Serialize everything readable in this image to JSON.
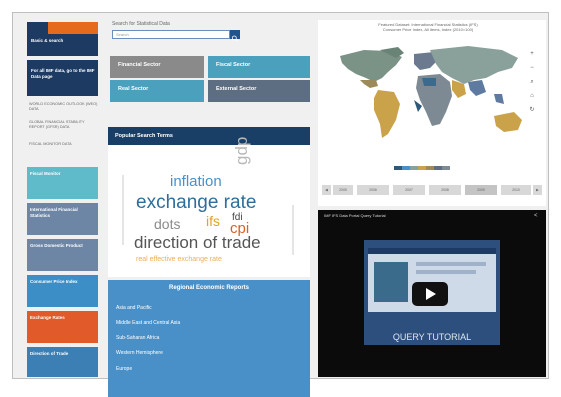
{
  "colors": {
    "navy": "#1d3a63",
    "orange": "#e56a1c",
    "teal": "#5fbac9",
    "blue": "#4a90c8"
  },
  "left": {
    "top_tile": "Basic & search",
    "data_tile": "For all IMF data, go to the IMF Data page",
    "links": [
      "World Economic Outlook (WEO) Data",
      "Global Financial Stability Report (GFSR) Data",
      "Fiscal Monitor Data"
    ],
    "tiles": [
      {
        "label": "Fiscal Monitor",
        "color": "#5fbac9"
      },
      {
        "label": "International Financial Statistics",
        "color": "#6e86a6"
      },
      {
        "label": "Gross Domestic Product",
        "color": "#6e86a6"
      },
      {
        "label": "Consumer Price Index",
        "color": "#3b8fc6"
      },
      {
        "label": "Exchange Rates",
        "color": "#e05a2a"
      },
      {
        "label": "Direction of Trade",
        "color": "#3b7fb4"
      }
    ]
  },
  "middle": {
    "search_title": "Search for Statistical Data",
    "search_placeholder": "Search",
    "sectors": [
      {
        "label": "Financial Sector",
        "color": "#8a8a8a"
      },
      {
        "label": "Fiscal Sector",
        "color": "#4aa0bd"
      },
      {
        "label": "Real Sector",
        "color": "#4aa0bd"
      },
      {
        "label": "External Sector",
        "color": "#5d6d82"
      }
    ],
    "popular_title": "Popular Search Terms",
    "cloud": {
      "w1": "inflation",
      "w2": "gdp",
      "w3": "exchange rate",
      "w4": "fdi",
      "w5": "cpi",
      "w6": "ifs",
      "w7": "dots",
      "w8": "direction of trade",
      "w9": "real effective exchange rate"
    },
    "reports_title": "Regional Economic Reports",
    "reports": [
      "Asia and Pacific",
      "Middle East and Central Asia",
      "Sub-Saharan Africa",
      "Western Hemisphere",
      "Europe"
    ]
  },
  "map": {
    "title_line1": "Featured Dataset: International Financial Statistics (IFS)",
    "title_line2": "Consumer Price Index, All items, Index (2010=100)",
    "years": [
      "2005",
      "2006",
      "2007",
      "2008",
      "2009",
      "2010"
    ]
  },
  "video": {
    "title": "IMF IFS Data Portal Query Tutorial",
    "screen_text": "QUERY TUTORIAL"
  }
}
